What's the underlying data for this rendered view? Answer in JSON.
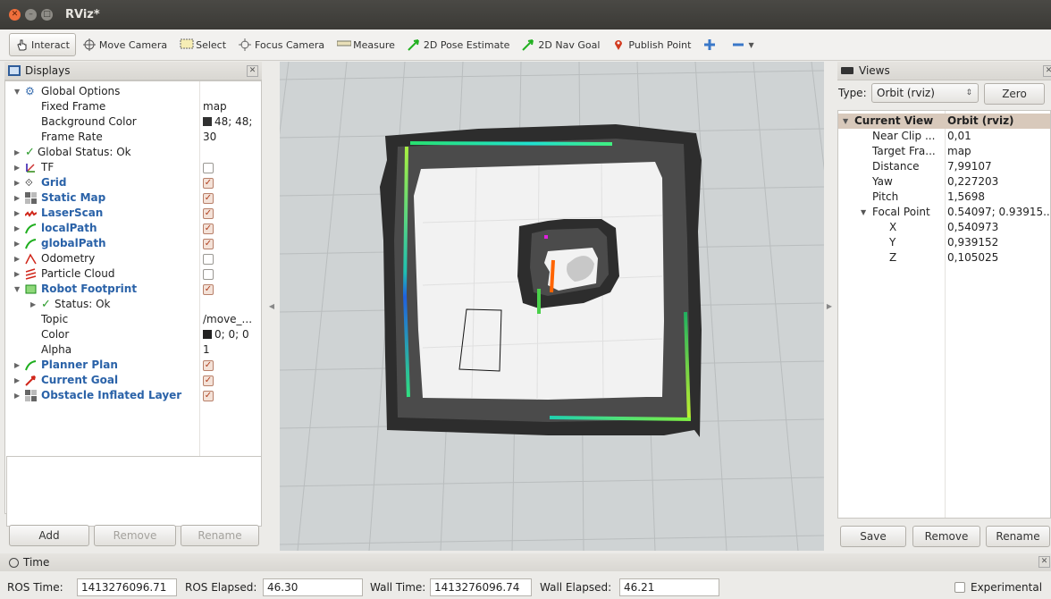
{
  "window": {
    "title": "RViz*"
  },
  "toolbar": {
    "interact": "Interact",
    "move_camera": "Move Camera",
    "select": "Select",
    "focus_camera": "Focus Camera",
    "measure": "Measure",
    "pose_estimate": "2D Pose Estimate",
    "nav_goal": "2D Nav Goal",
    "publish_point": "Publish Point"
  },
  "displays": {
    "title": "Displays",
    "rows": [
      {
        "label": "Global Options",
        "value": ""
      },
      {
        "label": "Fixed Frame",
        "value": "map"
      },
      {
        "label": "Background Color",
        "value": "48; 48;"
      },
      {
        "label": "Frame Rate",
        "value": "30"
      },
      {
        "label": "Global Status: Ok",
        "value": ""
      },
      {
        "label": "TF",
        "value": ""
      },
      {
        "label": "Grid",
        "value": ""
      },
      {
        "label": "Static Map",
        "value": ""
      },
      {
        "label": "LaserScan",
        "value": ""
      },
      {
        "label": "localPath",
        "value": ""
      },
      {
        "label": "globalPath",
        "value": ""
      },
      {
        "label": "Odometry",
        "value": ""
      },
      {
        "label": "Particle Cloud",
        "value": ""
      },
      {
        "label": "Robot Footprint",
        "value": ""
      },
      {
        "label": "Status: Ok",
        "value": ""
      },
      {
        "label": "Topic",
        "value": "/move_..."
      },
      {
        "label": "Color",
        "value": "0; 0; 0"
      },
      {
        "label": "Alpha",
        "value": "1"
      },
      {
        "label": "Planner Plan",
        "value": ""
      },
      {
        "label": "Current Goal",
        "value": ""
      },
      {
        "label": "Obstacle Inflated Layer",
        "value": ""
      }
    ],
    "buttons": {
      "add": "Add",
      "remove": "Remove",
      "rename": "Rename"
    }
  },
  "views": {
    "title": "Views",
    "type_label": "Type:",
    "type_value": "Orbit (rviz)",
    "zero": "Zero",
    "rows": [
      {
        "label": "Current View",
        "value": "Orbit (rviz)"
      },
      {
        "label": "Near Clip ...",
        "value": "0,01"
      },
      {
        "label": "Target Fra...",
        "value": "map"
      },
      {
        "label": "Distance",
        "value": "7,99107"
      },
      {
        "label": "Yaw",
        "value": "0,227203"
      },
      {
        "label": "Pitch",
        "value": "1,5698"
      },
      {
        "label": "Focal Point",
        "value": "0.54097; 0.93915..."
      },
      {
        "label": "X",
        "value": "0,540973"
      },
      {
        "label": "Y",
        "value": "0,939152"
      },
      {
        "label": "Z",
        "value": "0,105025"
      }
    ],
    "buttons": {
      "save": "Save",
      "remove": "Remove",
      "rename": "Rename"
    }
  },
  "time": {
    "title": "Time",
    "ros_time_label": "ROS Time:",
    "ros_time": "1413276096.71",
    "ros_elapsed_label": "ROS Elapsed:",
    "ros_elapsed": "46.30",
    "wall_time_label": "Wall Time:",
    "wall_time": "1413276096.74",
    "wall_elapsed_label": "Wall Elapsed:",
    "wall_elapsed": "46.21",
    "experimental": "Experimental"
  }
}
